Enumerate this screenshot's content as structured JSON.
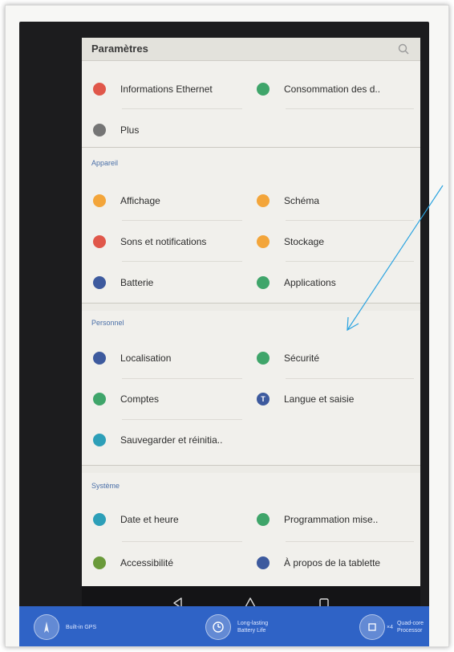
{
  "header": {
    "title": "Paramètres"
  },
  "top_items": [
    {
      "label": "Informations Ethernet",
      "icon": "ethernet-icon",
      "color": "#e0574a"
    },
    {
      "label": "Consommation des d..",
      "icon": "data-usage-icon",
      "color": "#3fa56a"
    },
    {
      "label": "Plus",
      "icon": "more-icon",
      "color": "#757575"
    }
  ],
  "sections": [
    {
      "label": "Appareil",
      "items": [
        {
          "label": "Affichage",
          "icon": "display-icon",
          "color": "#f3a53a"
        },
        {
          "label": "Schéma",
          "icon": "theme-icon",
          "color": "#f3a53a"
        },
        {
          "label": "Sons et notifications",
          "icon": "bell-icon",
          "color": "#e0574a"
        },
        {
          "label": "Stockage",
          "icon": "storage-icon",
          "color": "#f3a53a"
        },
        {
          "label": "Batterie",
          "icon": "battery-icon",
          "color": "#3d5a9e"
        },
        {
          "label": "Applications",
          "icon": "android-icon",
          "color": "#3fa56a"
        }
      ]
    },
    {
      "label": "Personnel",
      "items": [
        {
          "label": "Localisation",
          "icon": "location-icon",
          "color": "#3d5a9e"
        },
        {
          "label": "Sécurité",
          "icon": "lock-icon",
          "color": "#3fa56a"
        },
        {
          "label": "Comptes",
          "icon": "account-icon",
          "color": "#3fa56a"
        },
        {
          "label": "Langue et saisie",
          "icon": "language-icon",
          "color": "#3d5a9e",
          "glyph": "T"
        },
        {
          "label": "Sauvegarder et réinitia..",
          "icon": "backup-icon",
          "color": "#2d9fb8"
        }
      ]
    },
    {
      "label": "Système",
      "items": [
        {
          "label": "Date et heure",
          "icon": "clock-icon",
          "color": "#2d9fb8"
        },
        {
          "label": "Programmation mise..",
          "icon": "power-schedule-icon",
          "color": "#3fa56a"
        },
        {
          "label": "Accessibilité",
          "icon": "accessibility-icon",
          "color": "#6a9a3a"
        },
        {
          "label": "À propos de la tablette",
          "icon": "info-icon",
          "color": "#3d5a9e"
        }
      ]
    }
  ],
  "navbar": {
    "back": "back-icon",
    "home": "home-icon",
    "recents": "recents-icon"
  },
  "promo": [
    {
      "text": "Built-in GPS",
      "icon": "gps-icon"
    },
    {
      "text": "Long-lasting Battery Life",
      "icon": "battery-life-icon"
    },
    {
      "text": "Quad-core Processor",
      "icon": "processor-icon",
      "badge": "×4"
    }
  ],
  "colors": {
    "annotation_arrow": "#2aa3e0",
    "section_label": "#4a6fa8",
    "navbar": "#141416",
    "promo_band": "#2f63c6"
  }
}
